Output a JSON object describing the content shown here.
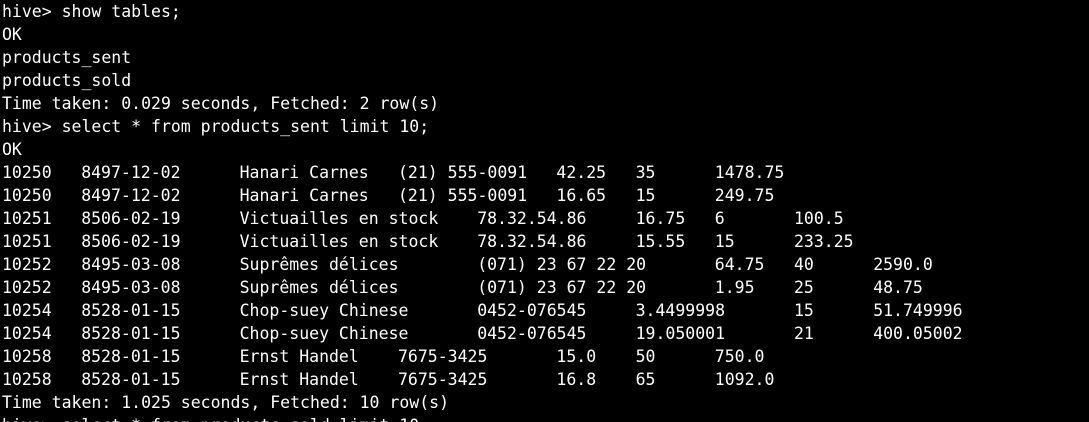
{
  "terminal": {
    "background": "#000000",
    "foreground": "#ffffff",
    "lines_before": [
      "hive> show tables;",
      "OK",
      "products_sent",
      "products_sold",
      "Time taken: 0.029 seconds, Fetched: 2 row(s)",
      "hive> select * from products_sent limit 10;",
      "OK"
    ],
    "rows": [
      {
        "cells": [
          "10250",
          "8497-12-02",
          "Hanari Carnes",
          "(21) 555-0091",
          "42.25",
          "35",
          "1478.75"
        ]
      },
      {
        "cells": [
          "10250",
          "8497-12-02",
          "Hanari Carnes",
          "(21) 555-0091",
          "16.65",
          "15",
          "249.75"
        ]
      },
      {
        "cells": [
          "10251",
          "8506-02-19",
          "Victuailles en stock",
          "78.32.54.86",
          "16.75",
          "6",
          "100.5"
        ]
      },
      {
        "cells": [
          "10251",
          "8506-02-19",
          "Victuailles en stock",
          "78.32.54.86",
          "15.55",
          "15",
          "233.25"
        ]
      },
      {
        "cells": [
          "10252",
          "8495-03-08",
          "Suprêmes délices",
          "(071) 23 67 22 20",
          "64.75",
          "40",
          "2590.0"
        ]
      },
      {
        "cells": [
          "10252",
          "8495-03-08",
          "Suprêmes délices",
          "(071) 23 67 22 20",
          "1.95",
          "25",
          "48.75"
        ]
      },
      {
        "cells": [
          "10254",
          "8528-01-15",
          "Chop-suey Chinese",
          "0452-076545",
          "3.4499998",
          "15",
          "51.749996"
        ]
      },
      {
        "cells": [
          "10254",
          "8528-01-15",
          "Chop-suey Chinese",
          "0452-076545",
          "19.050001",
          "21",
          "400.05002"
        ]
      },
      {
        "cells": [
          "10258",
          "8528-01-15",
          "Ernst Handel",
          "7675-3425",
          "15.0",
          "50",
          "750.0"
        ]
      },
      {
        "cells": [
          "10258",
          "8528-01-15",
          "Ernst Handel",
          "7675-3425",
          "16.8",
          "65",
          "1092.0"
        ]
      }
    ],
    "lines_after": [
      "Time taken: 1.025 seconds, Fetched: 10 row(s)"
    ]
  }
}
